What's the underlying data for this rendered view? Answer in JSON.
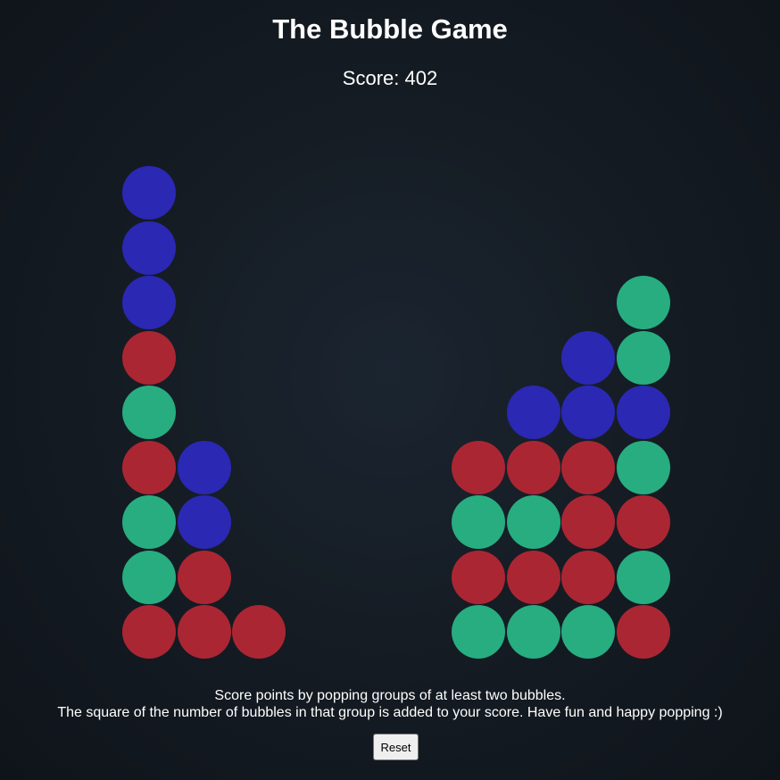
{
  "title": "The Bubble Game",
  "score_text": "Score: 402",
  "colors": {
    "blue": "#2b28b3",
    "red": "#ab2633",
    "green": "#27ad80"
  },
  "board": {
    "rows": 9,
    "columns": 10,
    "column_bubbles_bottom_to_top": [
      [
        "red",
        "green",
        "green",
        "red",
        "green",
        "red",
        "blue",
        "blue",
        "blue"
      ],
      [
        "red",
        "red",
        "blue",
        "blue"
      ],
      [
        "red"
      ],
      [],
      [],
      [],
      [
        "green",
        "red",
        "green",
        "red"
      ],
      [
        "green",
        "red",
        "green",
        "red",
        "blue"
      ],
      [
        "green",
        "red",
        "red",
        "red",
        "blue",
        "blue"
      ],
      [
        "red",
        "green",
        "red",
        "green",
        "blue",
        "green",
        "green"
      ]
    ]
  },
  "instructions": {
    "line1": "Score points by popping groups of at least two bubbles.",
    "line2": "The square of the number of bubbles in that group is added to your score. Have fun and happy popping :)"
  },
  "reset_label": "Reset"
}
